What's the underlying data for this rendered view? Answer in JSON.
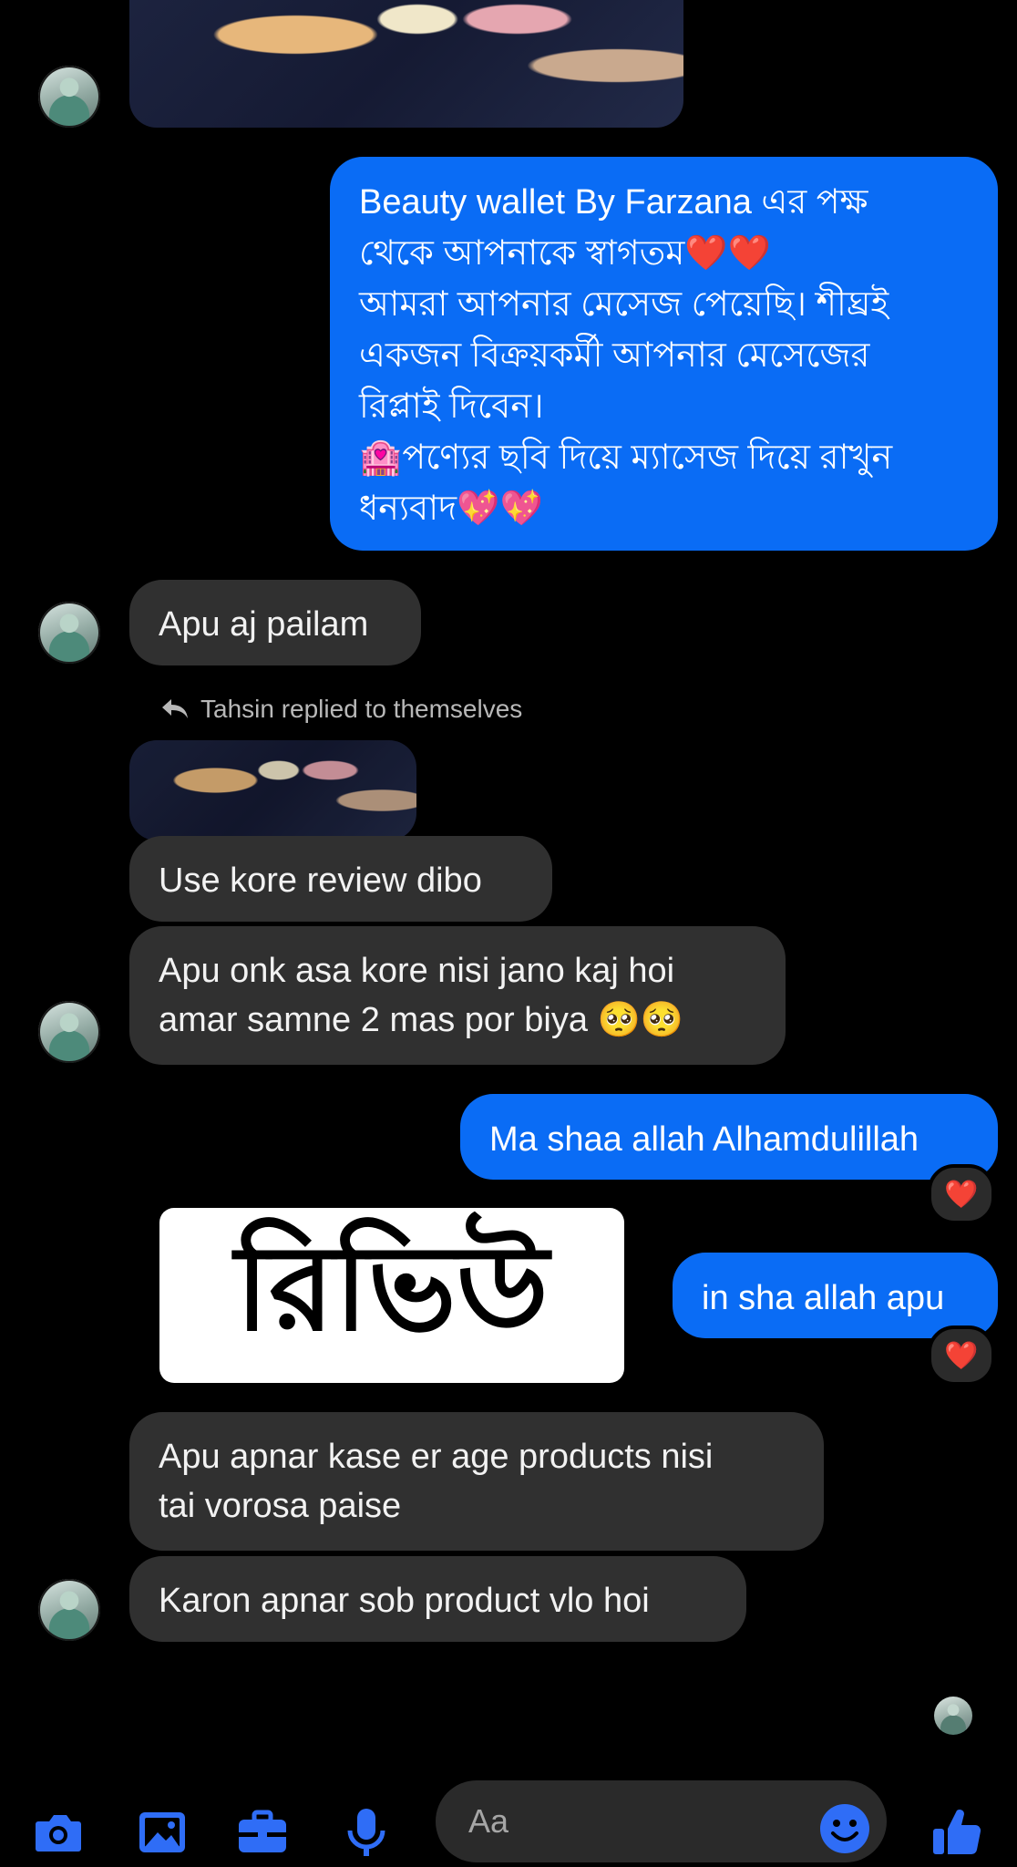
{
  "thread": {
    "welcome_message": {
      "lines": [
        "Beauty wallet By Farzana এর পক্ষ",
        "থেকে আপনাকে স্বাগতম❤️❤️",
        "আমরা আপনার মেসেজ পেয়েছি। শীঘ্রই",
        "একজন বিক্রয়কর্মী আপনার মেসেজের",
        "রিপ্লাই দিবেন।",
        "🏩পণ্যের ছবি দিয়ে ম্যাসেজ দিয়ে রাখুন",
        "ধন্যবাদ💖💖"
      ]
    },
    "msg_apu_aj": "Apu aj pailam",
    "reply_note": "Tahsin replied to themselves",
    "msg_use_kore": "Use kore review dibo",
    "msg_apu_onk": {
      "line1": "Apu onk asa kore nisi jano kaj hoi",
      "line2": "amar samne 2 mas por biya 🥺🥺"
    },
    "msg_ma_shaa": "Ma shaa allah Alhamdulillah",
    "msg_in_sha": "in sha allah apu",
    "reaction_heart": "❤️",
    "sticker_text": "রিভিউ",
    "msg_apu_apnar": {
      "line1": "Apu apnar kase er age products nisi",
      "line2": "tai vorosa paise"
    },
    "msg_karon": "Karon apnar sob product vlo hoi"
  },
  "composer": {
    "placeholder": "Aa",
    "icons": [
      "camera-icon",
      "gallery-icon",
      "briefcase-icon",
      "microphone-icon",
      "emoji-icon",
      "thumbs-up-icon"
    ]
  },
  "colors": {
    "accent_blue": "#0a6cf5",
    "icon_blue": "#2f6df6",
    "incoming_bubble": "#303030",
    "background": "#000000"
  }
}
